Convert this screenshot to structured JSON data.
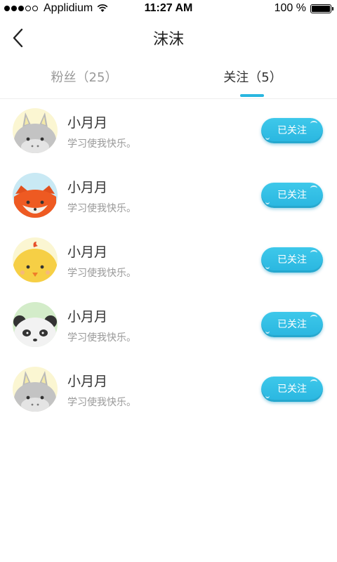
{
  "status_bar": {
    "carrier": "Applidium",
    "time": "11:27 AM",
    "battery": "100 %",
    "icons": [
      "signal-dots-icon",
      "wifi-icon",
      "battery-icon"
    ]
  },
  "nav": {
    "title": "沫沫",
    "back_icon": "chevron-left-icon"
  },
  "tabs": [
    {
      "label": "粉丝（25）",
      "active": false
    },
    {
      "label": "关注（5）",
      "active": true
    }
  ],
  "colors": {
    "accent": "#29b6e0",
    "button_bg": "#3ec8ea",
    "muted_text": "#999999"
  },
  "users": [
    {
      "name": "小月月",
      "signature": "学习使我快乐。",
      "button": "已关注",
      "avatar": "donkey-avatar"
    },
    {
      "name": "小月月",
      "signature": "学习使我快乐。",
      "button": "已关注",
      "avatar": "fox-avatar"
    },
    {
      "name": "小月月",
      "signature": "学习使我快乐。",
      "button": "已关注",
      "avatar": "chick-avatar"
    },
    {
      "name": "小月月",
      "signature": "学习使我快乐。",
      "button": "已关注",
      "avatar": "panda-avatar"
    },
    {
      "name": "小月月",
      "signature": "学习使我快乐。",
      "button": "已关注",
      "avatar": "donkey-avatar"
    }
  ]
}
